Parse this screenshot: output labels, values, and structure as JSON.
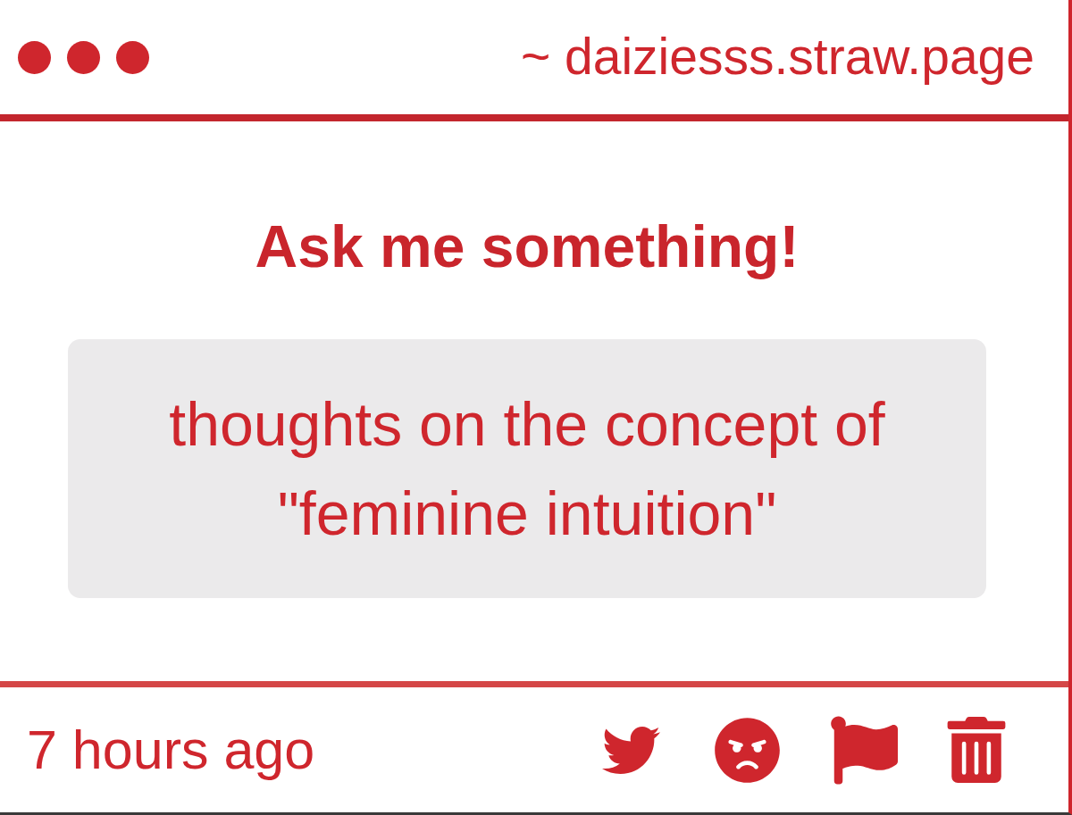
{
  "header": {
    "address": "~ daiziesss.straw.page"
  },
  "prompt": {
    "title": "Ask me something!"
  },
  "question": {
    "text": "thoughts on the concept of \"feminine intuition\""
  },
  "footer": {
    "time": "7 hours ago"
  }
}
